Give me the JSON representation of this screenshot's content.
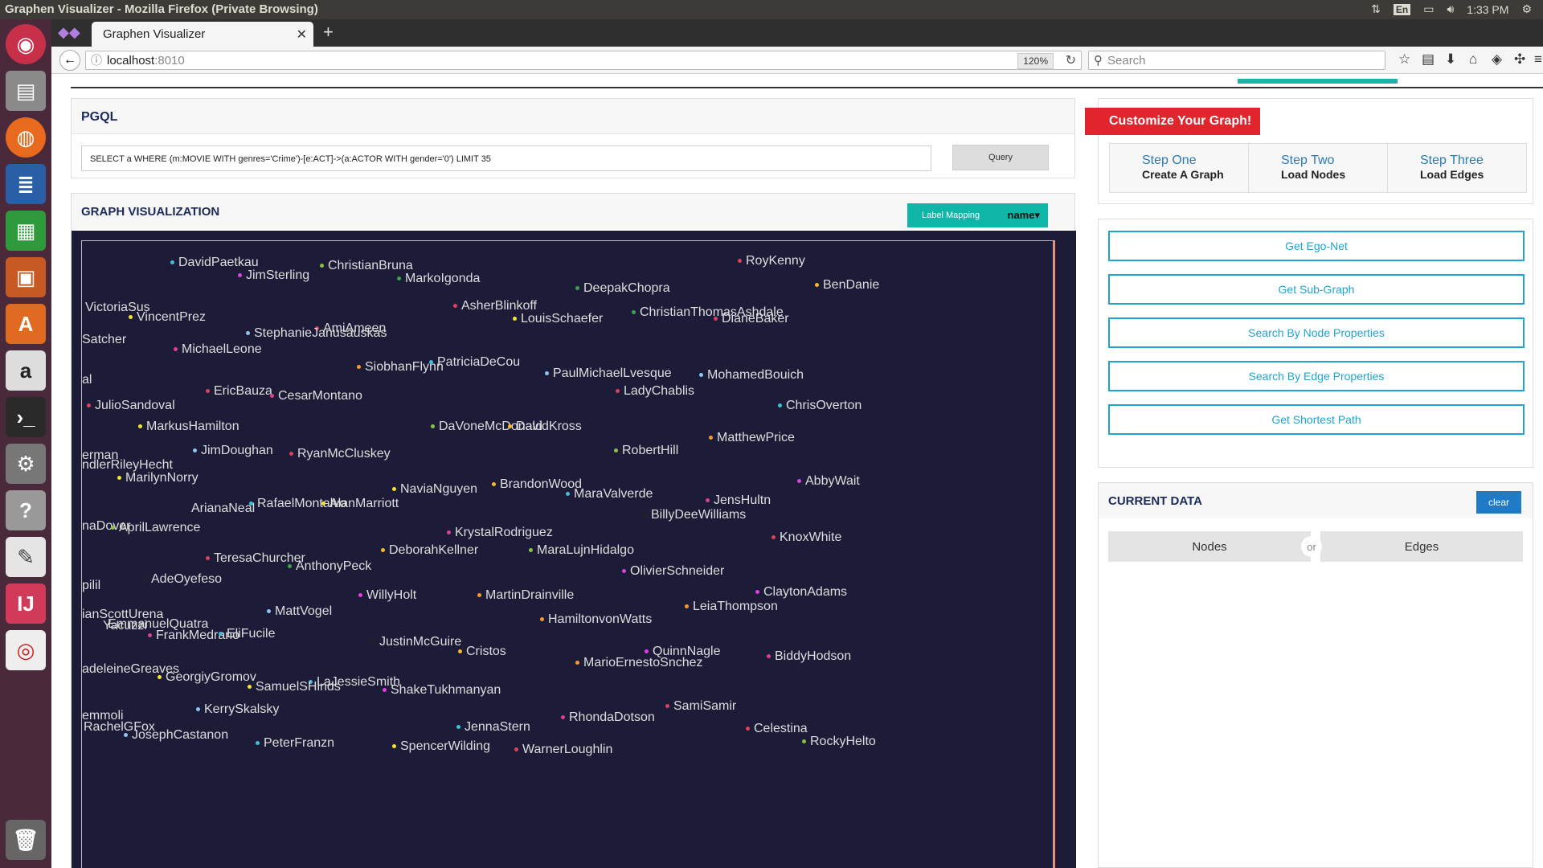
{
  "window_title": "Graphen Visualizer - Mozilla Firefox (Private Browsing)",
  "tray": {
    "lang": "En",
    "time": "1:33 PM"
  },
  "browser": {
    "tab_title": "Graphen Visualizer",
    "url_host": "localhost",
    "url_port": ":8010",
    "zoom": "120%",
    "search_placeholder": "Search"
  },
  "pgql": {
    "title": "PGQL",
    "query": "SELECT a WHERE (m:MOVIE WITH genres='Crime')-[e:ACT]->(a:ACTOR WITH gender='0') LIMIT 35",
    "button": "Query"
  },
  "graph": {
    "title": "GRAPH VISUALIZATION",
    "label_mapping": "Label Mapping",
    "mapping_value": "name",
    "nodes": [
      {
        "name": "DavidPaetkau",
        "color": "#3fc2d8"
      },
      {
        "name": "JimSterling",
        "color": "#e040e0"
      },
      {
        "name": "ChristianBruna",
        "color": "#8bc34a"
      },
      {
        "name": "MarkoIgonda",
        "color": "#3fa24a"
      },
      {
        "name": "RoyKenny",
        "color": "#e0405a"
      },
      {
        "name": "BenDanie",
        "color": "#f5b931"
      },
      {
        "name": "DeepakChopra",
        "color": "#3fa24a"
      },
      {
        "name": "VictoriaSus",
        "color": ""
      },
      {
        "name": "VincentPrez",
        "color": "#f5e431"
      },
      {
        "name": "AsherBlinkoff",
        "color": "#e0405a"
      },
      {
        "name": "LouisSchaefer",
        "color": "#f5e431"
      },
      {
        "name": "ChristianThomasAshdale",
        "color": "#3fa24a"
      },
      {
        "name": "DianeBaker",
        "color": "#e0405a"
      },
      {
        "name": "AmiAmeen",
        "color": "#e0405a"
      },
      {
        "name": "StephanieJanusauskas",
        "color": "#8fc6f0"
      },
      {
        "name": "Satcher",
        "color": ""
      },
      {
        "name": "MichaelLeone",
        "color": "#e0408a"
      },
      {
        "name": "SiobhanFlynn",
        "color": "#f59a31"
      },
      {
        "name": "PatriciaDeCou",
        "color": "#3fc2d8"
      },
      {
        "name": "PaulMichaelLvesque",
        "color": "#8fc6f0"
      },
      {
        "name": "MohamedBouich",
        "color": "#8fc6f0"
      },
      {
        "name": "al",
        "color": ""
      },
      {
        "name": "EricBauza",
        "color": "#e0405a"
      },
      {
        "name": "CesarMontano",
        "color": "#e0408a"
      },
      {
        "name": "LadyChablis",
        "color": "#e0405a"
      },
      {
        "name": "JulioSandoval",
        "color": "#e0405a"
      },
      {
        "name": "ChrisOverton",
        "color": "#3fc2d8"
      },
      {
        "name": "MarkusHamilton",
        "color": "#f5e431"
      },
      {
        "name": "DaVoneMcDonald",
        "color": "#8bc34a"
      },
      {
        "name": "DavidKross",
        "color": "#f5b931"
      },
      {
        "name": "MatthewPrice",
        "color": "#f59a31"
      },
      {
        "name": "JimDoughan",
        "color": "#8fc6f0"
      },
      {
        "name": "RyanMcCluskey",
        "color": "#e0405a"
      },
      {
        "name": "RobertHill",
        "color": "#8bc34a"
      },
      {
        "name": "erman",
        "color": ""
      },
      {
        "name": "ndlerRileyHecht",
        "color": ""
      },
      {
        "name": "MarilynNorry",
        "color": "#f5e431"
      },
      {
        "name": "AbbyWait",
        "color": "#e040e0"
      },
      {
        "name": "NaviaNguyen",
        "color": "#f5e431"
      },
      {
        "name": "BrandonWood",
        "color": "#f5b931"
      },
      {
        "name": "MaraValverde",
        "color": "#3fc2d8"
      },
      {
        "name": "JensHultn",
        "color": "#e0408a"
      },
      {
        "name": "ArianaNeal",
        "color": ""
      },
      {
        "name": "RafaelMontalvo",
        "color": "#3fc2d8"
      },
      {
        "name": "AlanMarriott",
        "color": "#f5e431"
      },
      {
        "name": "BillyDeeWilliams",
        "color": "#222222"
      },
      {
        "name": "naDover",
        "color": ""
      },
      {
        "name": "AprilLawrence",
        "color": "#8bc34a"
      },
      {
        "name": "KrystalRodriguez",
        "color": "#e0408a"
      },
      {
        "name": "KnoxWhite",
        "color": "#e0405a"
      },
      {
        "name": "DeborahKellner",
        "color": "#f5b931"
      },
      {
        "name": "MaraLujnHidalgo",
        "color": "#8bc34a"
      },
      {
        "name": "TeresaChurcher",
        "color": "#e0405a"
      },
      {
        "name": "AnthonyPeck",
        "color": "#3fa24a"
      },
      {
        "name": "OlivierSchneider",
        "color": "#e040e0"
      },
      {
        "name": "AdeOyefeso",
        "color": "#222222"
      },
      {
        "name": "pilil",
        "color": ""
      },
      {
        "name": "WillyHolt",
        "color": "#e040e0"
      },
      {
        "name": "MartinDrainville",
        "color": "#f59a31"
      },
      {
        "name": "ClaytonAdams",
        "color": "#e040e0"
      },
      {
        "name": "MattVogel",
        "color": "#8fc6f0"
      },
      {
        "name": "LeiaThompson",
        "color": "#f59a31"
      },
      {
        "name": "ianScottUrena",
        "color": ""
      },
      {
        "name": "EmmanuelQuatra",
        "color": ""
      },
      {
        "name": "Yacuzzi",
        "color": ""
      },
      {
        "name": "HamiltonvonWatts",
        "color": "#f59a31"
      },
      {
        "name": "FrankMedrano",
        "color": "#e0408a"
      },
      {
        "name": "EliFucile",
        "color": "#3fc2d8"
      },
      {
        "name": "JustinMcGuire",
        "color": "#222222"
      },
      {
        "name": "Cristos",
        "color": "#f5b931"
      },
      {
        "name": "QuinnNagle",
        "color": "#e040e0"
      },
      {
        "name": "BiddyHodson",
        "color": "#e0408a"
      },
      {
        "name": "MarioErnestoSnchez",
        "color": "#f59a31"
      },
      {
        "name": "adeleineGreaves",
        "color": ""
      },
      {
        "name": "GeorgiyGromov",
        "color": "#f5e431"
      },
      {
        "name": "LaJessieSmith",
        "color": "#3fc2d8"
      },
      {
        "name": "SamuelSHinds",
        "color": "#f5e431"
      },
      {
        "name": "ShakeTukhmanyan",
        "color": "#e040e0"
      },
      {
        "name": "KerrySkalsky",
        "color": "#8fc6f0"
      },
      {
        "name": "SamiSamir",
        "color": "#e0405a"
      },
      {
        "name": "emmoli",
        "color": ""
      },
      {
        "name": "RachelGFox",
        "color": ""
      },
      {
        "name": "JennaStern",
        "color": "#3fc2d8"
      },
      {
        "name": "RhondaDotson",
        "color": "#e0408a"
      },
      {
        "name": "Celestina",
        "color": "#e0405a"
      },
      {
        "name": "JosephCastanon",
        "color": "#8fc6f0"
      },
      {
        "name": "PeterFranzn",
        "color": "#3fc2d8"
      },
      {
        "name": "SpencerWilding",
        "color": "#f5e431"
      },
      {
        "name": "WarnerLoughlin",
        "color": "#e0405a"
      },
      {
        "name": "RockyHelto",
        "color": "#8bc34a"
      }
    ]
  },
  "wizard": {
    "ribbon": "Customize Your Graph!",
    "steps": [
      {
        "title": "Step One",
        "sub": "Create A Graph"
      },
      {
        "title": "Step Two",
        "sub": "Load Nodes"
      },
      {
        "title": "Step Three",
        "sub": "Load Edges"
      }
    ]
  },
  "actions": [
    "Get Ego-Net",
    "Get Sub-Graph",
    "Search By Node Properties",
    "Search By Edge Properties",
    "Get Shortest Path"
  ],
  "current_data": {
    "title": "CURRENT DATA",
    "clear": "clear",
    "nodes": "Nodes",
    "or": "or",
    "edges": "Edges"
  }
}
